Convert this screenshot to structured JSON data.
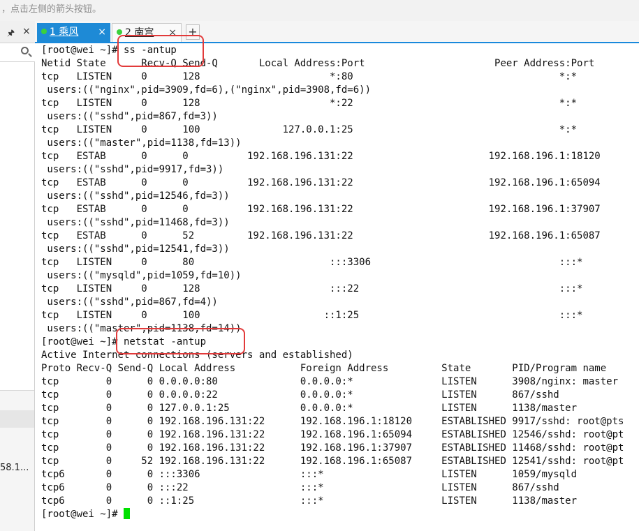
{
  "top_hint": "，点击左侧的箭头按钮。",
  "left_panel": {
    "pin_glyph": "ᵖ",
    "close_glyph": "×",
    "item_text": "58.1..."
  },
  "tabs": [
    {
      "number": "1",
      "label": "1 乘风",
      "active": true,
      "status_color": "#3bd13b"
    },
    {
      "number": "2",
      "label": "2 南宫",
      "active": false,
      "status_color": "#3bd13b"
    }
  ],
  "tab_close_glyph": "×",
  "add_tab_glyph": "+",
  "terminal": {
    "lines": [
      "[root@wei ~]# ss -antup",
      "Netid State      Recv-Q Send-Q       Local Address:Port                      Peer Address:Port",
      "tcp   LISTEN     0      128                      *:80                                   *:*",
      " users:((\"nginx\",pid=3909,fd=6),(\"nginx\",pid=3908,fd=6))",
      "tcp   LISTEN     0      128                      *:22                                   *:*",
      " users:((\"sshd\",pid=867,fd=3))",
      "tcp   LISTEN     0      100              127.0.0.1:25                                   *:*",
      " users:((\"master\",pid=1138,fd=13))",
      "tcp   ESTAB      0      0          192.168.196.131:22                       192.168.196.1:18120",
      " users:((\"sshd\",pid=9917,fd=3))",
      "tcp   ESTAB      0      0          192.168.196.131:22                       192.168.196.1:65094",
      " users:((\"sshd\",pid=12546,fd=3))",
      "tcp   ESTAB      0      0          192.168.196.131:22                       192.168.196.1:37907",
      " users:((\"sshd\",pid=11468,fd=3))",
      "tcp   ESTAB      0      52         192.168.196.131:22                       192.168.196.1:65087",
      " users:((\"sshd\",pid=12541,fd=3))",
      "tcp   LISTEN     0      80                       :::3306                                :::*",
      " users:((\"mysqld\",pid=1059,fd=10))",
      "tcp   LISTEN     0      128                      :::22                                  :::*",
      " users:((\"sshd\",pid=867,fd=4))",
      "tcp   LISTEN     0      100                     ::1:25                                  :::*",
      " users:((\"master\",pid=1138,fd=14))",
      "[root@wei ~]# netstat -antup",
      "Active Internet connections (servers and established)",
      "Proto Recv-Q Send-Q Local Address           Foreign Address         State       PID/Program name",
      "tcp        0      0 0.0.0.0:80              0.0.0.0:*               LISTEN      3908/nginx: master",
      "tcp        0      0 0.0.0.0:22              0.0.0.0:*               LISTEN      867/sshd",
      "tcp        0      0 127.0.0.1:25            0.0.0.0:*               LISTEN      1138/master",
      "tcp        0      0 192.168.196.131:22      192.168.196.1:18120     ESTABLISHED 9917/sshd: root@pts",
      "tcp        0      0 192.168.196.131:22      192.168.196.1:65094     ESTABLISHED 12546/sshd: root@pt",
      "tcp        0      0 192.168.196.131:22      192.168.196.1:37907     ESTABLISHED 11468/sshd: root@pt",
      "tcp        0     52 192.168.196.131:22      192.168.196.1:65087     ESTABLISHED 12541/sshd: root@pt",
      "tcp6       0      0 :::3306                 :::*                    LISTEN      1059/mysqld",
      "tcp6       0      0 :::22                   :::*                    LISTEN      867/sshd",
      "tcp6       0      0 ::1:25                  :::*                    LISTEN      1138/master",
      "[root@wei ~]# "
    ],
    "cursor_color": "#00e000"
  },
  "annotation_color": "#e23a3a"
}
